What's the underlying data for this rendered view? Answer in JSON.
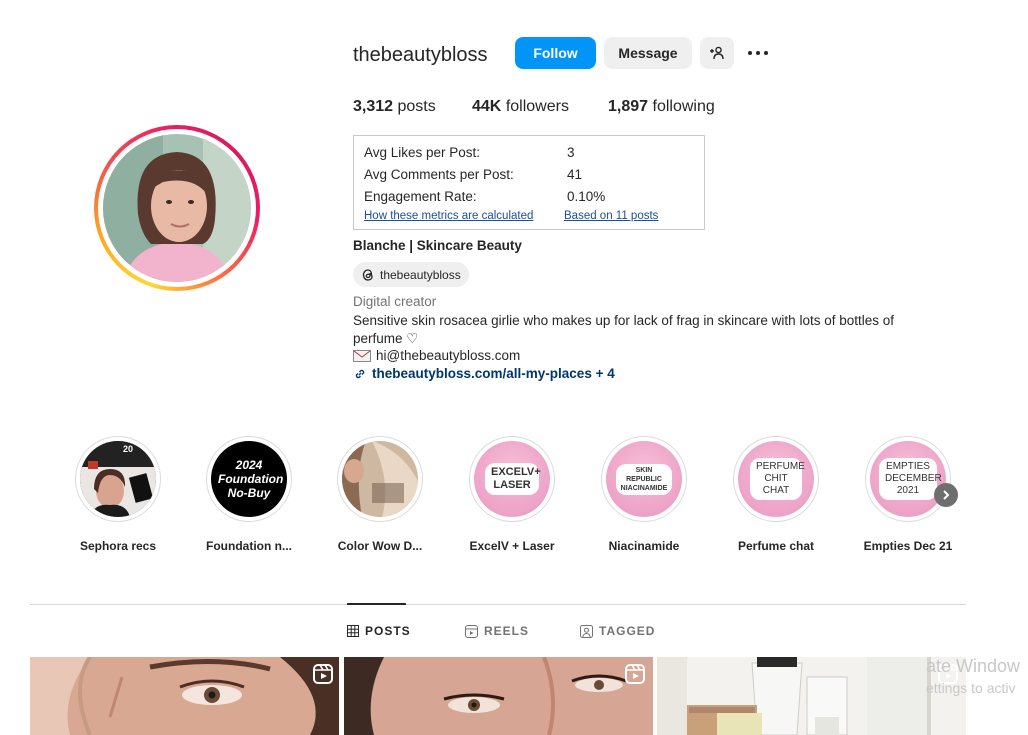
{
  "profile": {
    "username": "thebeautybloss",
    "full_name": "Blanche | Skincare Beauty",
    "threads_handle": "thebeautybloss",
    "category": "Digital creator",
    "bio": "Sensitive skin rosacea girlie who makes up for lack of frag in skincare with lots of bottles of perfume ♡",
    "email": "hi@thebeautybloss.com",
    "link": "thebeautybloss.com/all-my-places",
    "link_more": " + 4"
  },
  "actions": {
    "follow": "Follow",
    "message": "Message"
  },
  "stats": {
    "posts_count": "3,312",
    "posts_label": "posts",
    "followers_count": "44K",
    "followers_label": "followers",
    "following_count": "1,897",
    "following_label": "following"
  },
  "metrics": {
    "avg_likes_label": "Avg Likes per Post:",
    "avg_likes_value": "3",
    "avg_comments_label": "Avg Comments per Post:",
    "avg_comments_value": "41",
    "engagement_label": "Engagement Rate:",
    "engagement_value": "0.10%",
    "how_link": "How these metrics are calculated",
    "based_link": "Based on 11 posts"
  },
  "highlights": [
    {
      "label": "Sephora recs",
      "cover_text": "20"
    },
    {
      "label": "Foundation n...",
      "cover_text": "2024 Foundation No-Buy"
    },
    {
      "label": "Color Wow D...",
      "cover_text": ""
    },
    {
      "label": "ExcelV + Laser",
      "cover_text": "EXCELV+ LASER"
    },
    {
      "label": "Niacinamide",
      "cover_text": "SKIN REPUBLIC NIACINAMIDE"
    },
    {
      "label": "Perfume chat",
      "cover_text": "PERFUME CHIT CHAT"
    },
    {
      "label": "Empties Dec 21",
      "cover_text": "EMPTIES DECEMBER 2021"
    }
  ],
  "tabs": [
    {
      "label": "POSTS",
      "icon": "grid-icon",
      "active": true
    },
    {
      "label": "REELS",
      "icon": "reels-icon",
      "active": false
    },
    {
      "label": "TAGGED",
      "icon": "tagged-icon",
      "active": false
    }
  ],
  "watermark": {
    "line1": "ate Window",
    "line2": "ettings to activ"
  },
  "colors": {
    "follow_blue": "#0095f6",
    "link_blue": "#00376b",
    "metric_link": "#1a4fa0"
  }
}
